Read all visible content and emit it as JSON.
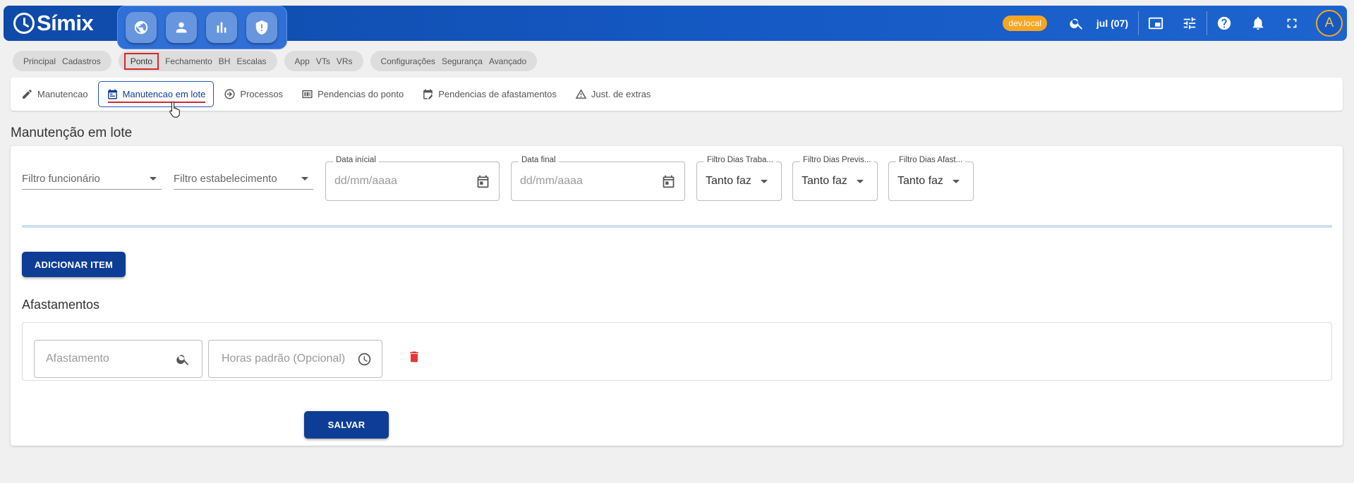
{
  "brand": {
    "name": "Símix"
  },
  "topbar": {
    "quick_icons": [
      "globe-icon",
      "person-icon",
      "bar-chart-icon",
      "shield-icon"
    ],
    "env_badge": "dev.local",
    "period": "jul (07)",
    "avatar_letter": "A",
    "icons": [
      "search-icon",
      "picture-in-picture-icon",
      "tune-icon",
      "help-icon",
      "bell-icon",
      "fullscreen-icon"
    ],
    "colors": {
      "bar": "#1559c4",
      "badge": "#f5a623"
    }
  },
  "module_groups": [
    {
      "items": [
        "Principal",
        "Cadastros"
      ]
    },
    {
      "items": [
        "Ponto",
        "Fechamento",
        "BH",
        "Escalas"
      ],
      "active": "Ponto"
    },
    {
      "items": [
        "App",
        "VTs",
        "VRs"
      ]
    },
    {
      "items": [
        "Configurações",
        "Segurança",
        "Avançado"
      ]
    }
  ],
  "subnav": {
    "items": [
      {
        "label": "Manutencao",
        "icon": "pencil-icon"
      },
      {
        "label": "Manutencao em lote",
        "icon": "calendar-icon",
        "active": true
      },
      {
        "label": "Processos",
        "icon": "arrow-circle-icon"
      },
      {
        "label": "Pendencias do ponto",
        "icon": "id-card-icon"
      },
      {
        "label": "Pendencias de afastamentos",
        "icon": "calendar-edit-icon"
      },
      {
        "label": "Just. de extras",
        "icon": "warning-icon"
      }
    ]
  },
  "page": {
    "title": "Manutenção em lote"
  },
  "filters": {
    "funcionario": "Filtro funcionário",
    "estabelecimento": "Filtro estabelecimento",
    "data_inicial": {
      "label": "Data inícial",
      "placeholder": "dd/mm/aaaa"
    },
    "data_final": {
      "label": "Data final",
      "placeholder": "dd/mm/aaaa"
    },
    "dias_trab": {
      "label": "Filtro Dias Traba...",
      "value": "Tanto faz"
    },
    "dias_prev": {
      "label": "Filtro Dias Previs...",
      "value": "Tanto faz"
    },
    "dias_afast": {
      "label": "Filtro Dias Afast...",
      "value": "Tanto faz"
    }
  },
  "actions": {
    "add_item": "ADICIONAR ITEM",
    "save": "SALVAR"
  },
  "afastamentos": {
    "title": "Afastamentos",
    "afastamento_placeholder": "Afastamento",
    "horas_placeholder": "Horas padrão (Opcional)"
  }
}
